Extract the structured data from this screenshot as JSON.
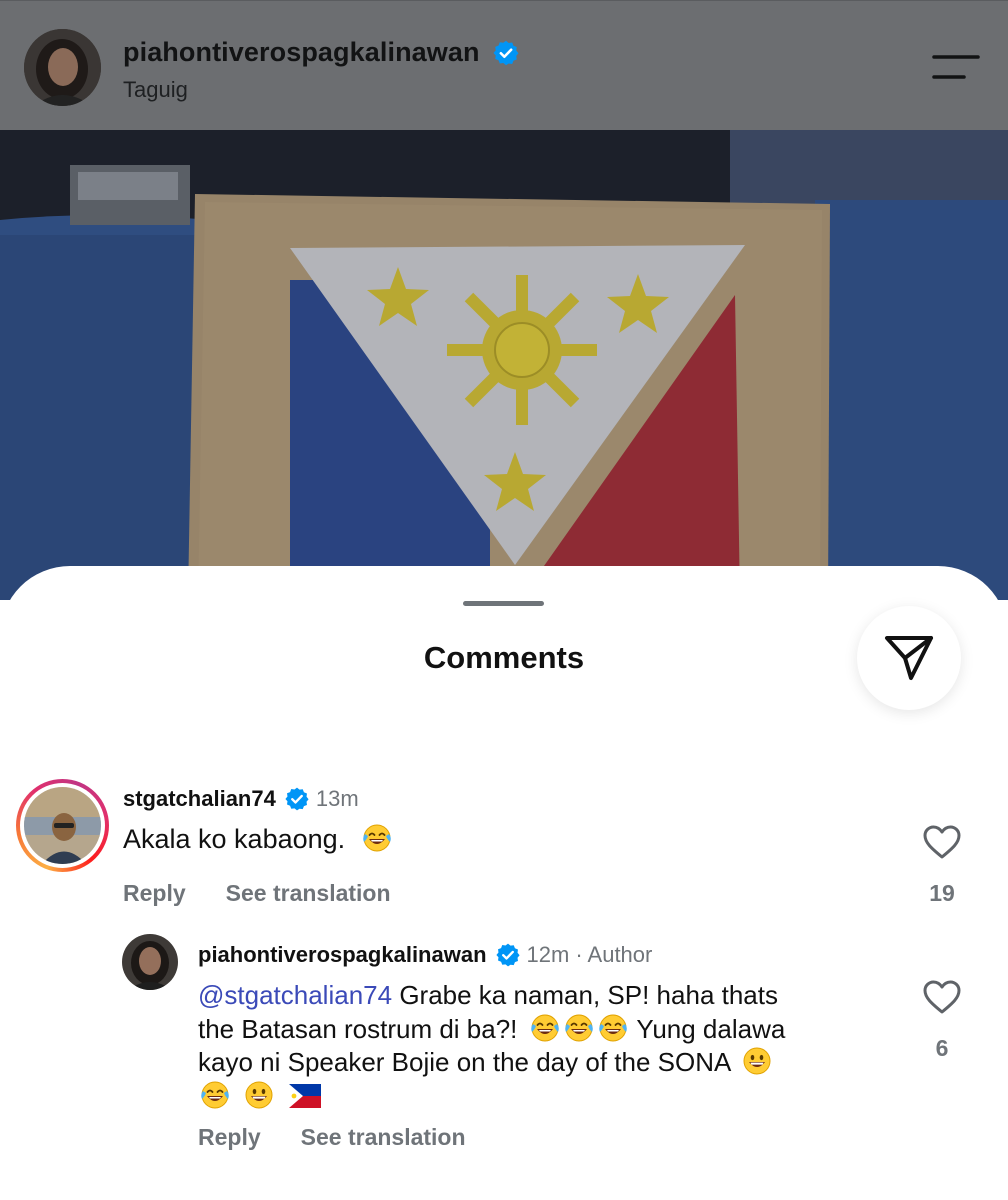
{
  "post": {
    "username": "piahontiverospagkalinawan",
    "location": "Taguig",
    "verified": true,
    "menu_icon": "hamburger-menu-icon"
  },
  "colors": {
    "verified_blue": "#0095f6",
    "mention_blue": "#3b4ab8",
    "muted_text": "#6f7479",
    "overlay": "#6c6e71"
  },
  "sheet": {
    "title": "Comments",
    "share_icon": "send-paper-plane-icon"
  },
  "comments": [
    {
      "username": "stgatchalian74",
      "verified": true,
      "time": "13m",
      "text": "Akala ko kabaong.",
      "emojis": [
        "face-with-tears-of-joy"
      ],
      "reply_label": "Reply",
      "translate_label": "See translation",
      "likes": "19",
      "has_story_ring": true
    },
    {
      "username": "piahontiverospagkalinawan",
      "verified": true,
      "time": "12m",
      "badge": "· Author",
      "mention": "@stgatchalian74",
      "text_line1": "Grabe ka naman, SP! haha thats",
      "text_line2": "the Batasan rostrum di ba?!",
      "text_line3": "Yung dalawa",
      "text_line4": "kayo ni Speaker Bojie on the day of the SONA",
      "reply_label": "Reply",
      "translate_label": "See translation",
      "likes": "6",
      "emojis_line2": [
        "face-with-tears-of-joy",
        "face-with-tears-of-joy",
        "face-with-tears-of-joy"
      ],
      "emojis_line4": [
        "grinning-face"
      ],
      "emojis_line5": [
        "face-with-tears-of-joy",
        "grinning-face",
        "philippines-flag"
      ]
    }
  ]
}
